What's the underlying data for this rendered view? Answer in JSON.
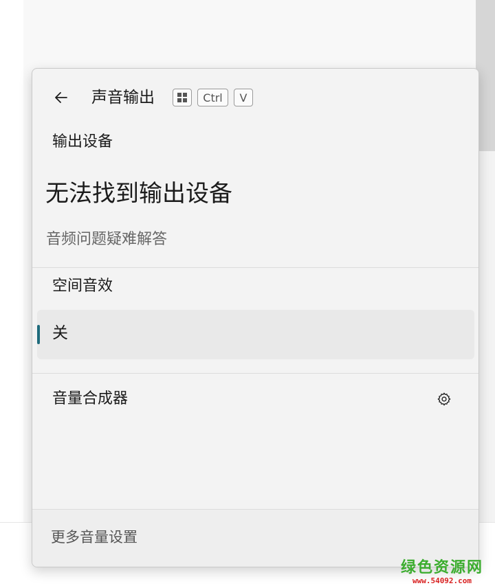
{
  "flyout": {
    "title": "声音输出",
    "shortcut_keys": [
      "⊞",
      "Ctrl",
      "V"
    ],
    "output_device_label": "输出设备",
    "no_device_message": "无法找到输出设备",
    "troubleshoot_link": "音频问题疑难解答",
    "spatial_sound_label": "空间音效",
    "spatial_sound_selected": "关",
    "volume_mixer_label": "音量合成器",
    "more_settings_link": "更多音量设置"
  },
  "watermark": {
    "top": "绿色资源网",
    "bottom": "www.54092.com"
  },
  "colors": {
    "accent": "#1f6b7c",
    "flyout_bg": "#f3f3f3",
    "selected_bg": "#e9e9e9"
  }
}
